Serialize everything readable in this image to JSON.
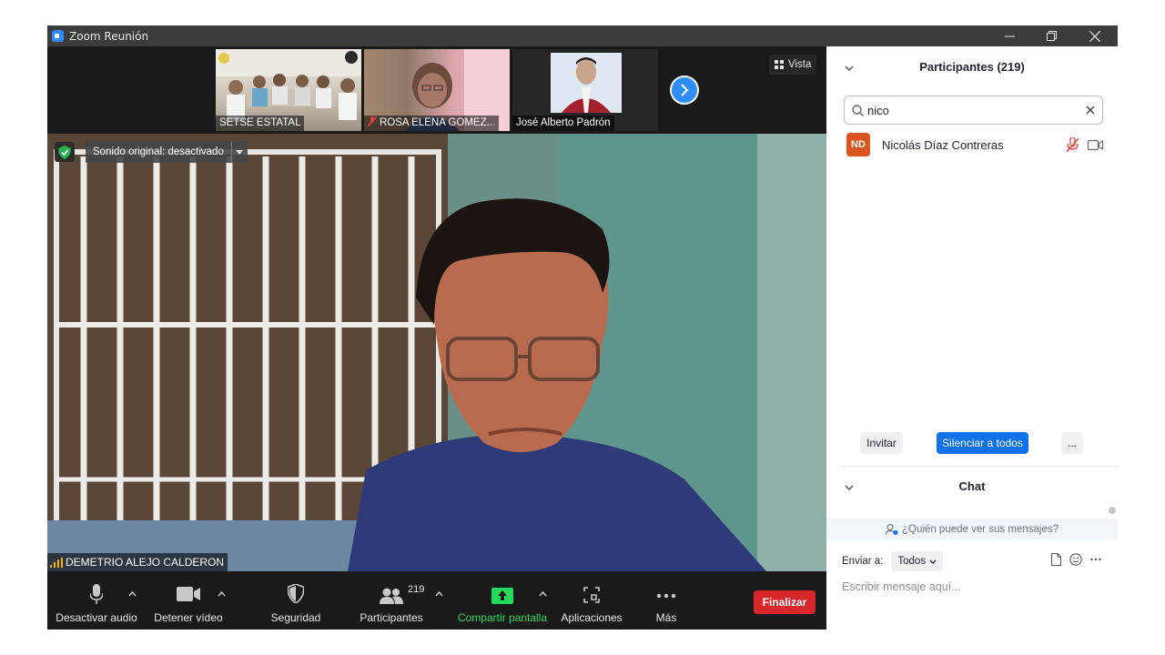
{
  "window": {
    "title": "Zoom Reunión"
  },
  "thumbnails": [
    {
      "label": "SETSE ESTATAL",
      "muted": false
    },
    {
      "label": "ROSA ELENA GOMEZ...",
      "muted": true
    },
    {
      "label": "José Alberto Padrón",
      "muted": false
    }
  ],
  "view_button": {
    "label": "Vista"
  },
  "main_video": {
    "sound_label": "Sonido original: desactivado",
    "speaker_name": "DEMETRIO ALEJO CALDERON"
  },
  "toolbar": {
    "audio_label": "Desactivar audio",
    "video_label": "Detener vídeo",
    "security_label": "Seguridad",
    "participants_label": "Participantes",
    "participants_count": "219",
    "share_label": "Compartir pantalla",
    "apps_label": "Aplicaciones",
    "more_label": "Más",
    "end_label": "Finalizar"
  },
  "participants_panel": {
    "title": "Participantes (219)",
    "search_value": "nico",
    "participants": [
      {
        "initials": "ND",
        "name": "Nicolás Díaz Contreras",
        "avatar_color": "#d9541e"
      }
    ],
    "invite_label": "Invitar",
    "mute_all_label": "Silenciar a todos",
    "more_label": "..."
  },
  "chat_panel": {
    "title": "Chat",
    "who_can_see": "¿Quién puede ver sus mensajes?",
    "send_to_label": "Enviar a:",
    "send_to_value": "Todos",
    "input_placeholder": "Escribir mensaje aquí..."
  },
  "colors": {
    "accent_blue": "#0e72ed",
    "end_red": "#d8262d",
    "share_green": "#23d959"
  }
}
